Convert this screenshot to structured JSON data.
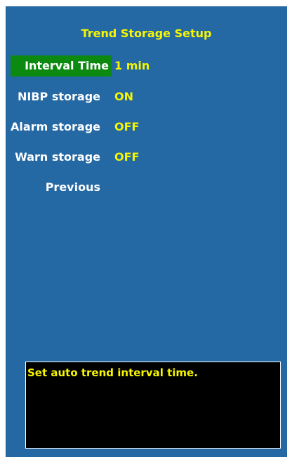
{
  "colors": {
    "panel_bg": "#2468a4",
    "highlight": "#0c8a10",
    "value_text": "#f6f600",
    "label_text": "#ffffff",
    "help_bg": "#000000"
  },
  "menu": {
    "title": "Trend Storage Setup",
    "items": [
      {
        "label": "Interval Time",
        "value": "1 min",
        "selected": true
      },
      {
        "label": "NIBP storage",
        "value": "ON"
      },
      {
        "label": "Alarm storage",
        "value": "OFF"
      },
      {
        "label": "Warn storage",
        "value": "OFF"
      },
      {
        "label": "Previous"
      }
    ]
  },
  "help": {
    "text": "Set auto trend interval time."
  }
}
